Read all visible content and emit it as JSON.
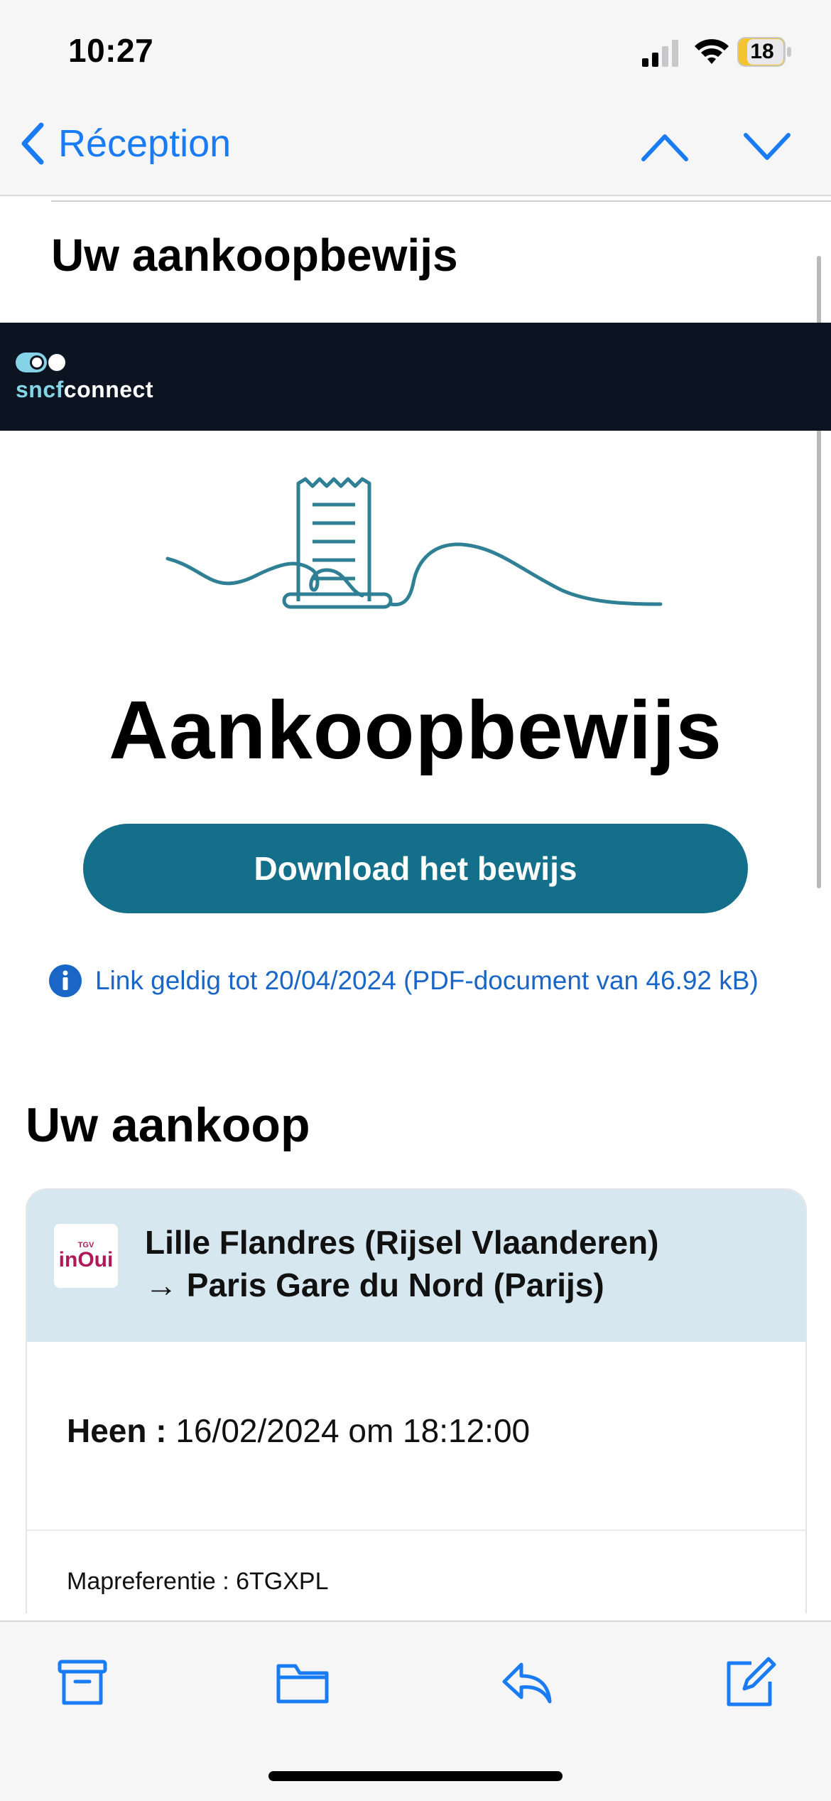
{
  "status_bar": {
    "time": "10:27",
    "battery_level": "18",
    "icons": [
      "cellular-signal-icon",
      "wifi-icon",
      "battery-icon"
    ]
  },
  "nav": {
    "back_label": "Réception",
    "icons": [
      "chevron-left-icon",
      "chevron-up-icon",
      "chevron-down-icon"
    ]
  },
  "email": {
    "subject": "Uw aankoopbewijs",
    "brand": {
      "prefix": "sncf",
      "suffix": "connect",
      "color": "#0c1421"
    },
    "hero_title": "Aankoopbewijs",
    "download_button": "Download het bewijs",
    "link_info": "Link geldig tot 20/04/2024 (PDF-document van 46.92 kB)",
    "section_title": "Uw aankoop",
    "card": {
      "logo_small": "TGV",
      "logo_main": "inOui",
      "route_line1": "Lille Flandres (Rijsel Vlaanderen)",
      "route_line2": "→ Paris Gare du Nord (Parijs)",
      "trip_label": "Heen :",
      "trip_value": "16/02/2024 om 18:12:00",
      "reference": "Mapreferentie : 6TGXPL"
    }
  },
  "toolbar": {
    "icons": [
      "archive-icon",
      "folder-icon",
      "reply-icon",
      "compose-icon"
    ]
  },
  "colors": {
    "accent": "#1a7cf4",
    "button": "#136f8a",
    "link": "#1a66c7",
    "card_header": "#d6e7f0"
  }
}
